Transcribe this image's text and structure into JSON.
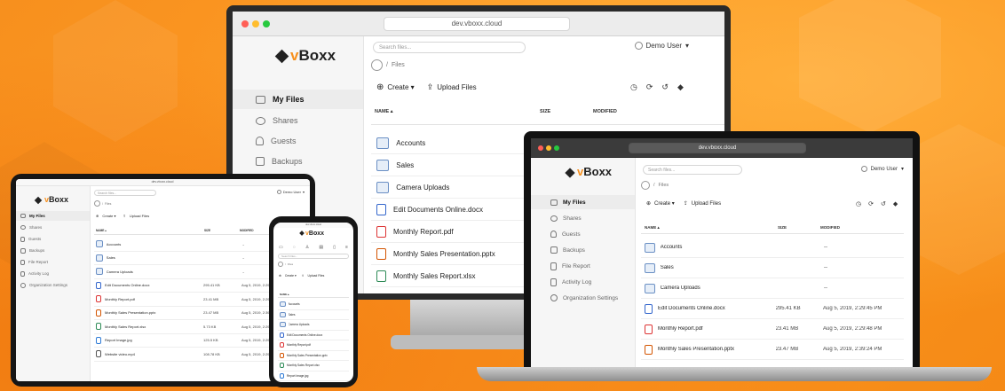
{
  "url": "dev.vboxx.cloud",
  "brand": {
    "prefix": "v",
    "name": "Boxx"
  },
  "user": "Demo User",
  "search_placeholder": "Search files...",
  "breadcrumb": "Files",
  "toolbar": {
    "create": "Create ▾",
    "upload": "Upload Files"
  },
  "nav": [
    {
      "label": "My Files",
      "icon": "folder-icon"
    },
    {
      "label": "Shares",
      "icon": "share-icon"
    },
    {
      "label": "Guests",
      "icon": "guest-icon"
    },
    {
      "label": "Backups",
      "icon": "backup-icon"
    },
    {
      "label": "File Report",
      "icon": "report-icon"
    },
    {
      "label": "Activity Log",
      "icon": "log-icon"
    },
    {
      "label": "Organization Settings",
      "icon": "settings-icon"
    }
  ],
  "columns": {
    "name": "NAME ▴",
    "size": "SIZE",
    "modified": "MODIFIED"
  },
  "files_monitor": [
    {
      "name": "Accounts",
      "type": "folder"
    },
    {
      "name": "Sales",
      "type": "folder"
    },
    {
      "name": "Camera Uploads",
      "type": "folder"
    },
    {
      "name": "Edit Documents Online.docx",
      "type": "doc"
    },
    {
      "name": "Monthly Report.pdf",
      "type": "pdf"
    },
    {
      "name": "Monthly Sales Presentation.pptx",
      "type": "ppt"
    },
    {
      "name": "Monthly Sales Report.xlsx",
      "type": "xls"
    }
  ],
  "files_laptop": [
    {
      "name": "Accounts",
      "type": "folder",
      "size": "",
      "modified": "--"
    },
    {
      "name": "Sales",
      "type": "folder",
      "size": "",
      "modified": "--"
    },
    {
      "name": "Camera Uploads",
      "type": "folder",
      "size": "",
      "modified": "--"
    },
    {
      "name": "Edit Documents Online.docx",
      "type": "doc",
      "size": "295.41 KB",
      "modified": "Aug 5, 2019, 2:29:45 PM"
    },
    {
      "name": "Monthly Report.pdf",
      "type": "pdf",
      "size": "23.41 MB",
      "modified": "Aug 5, 2019, 2:29:48 PM"
    },
    {
      "name": "Monthly Sales Presentation.pptx",
      "type": "ppt",
      "size": "23.47 MB",
      "modified": "Aug 5, 2019, 2:39:24 PM"
    }
  ],
  "files_tablet": [
    {
      "name": "Accounts",
      "type": "folder",
      "size": "",
      "modified": "--"
    },
    {
      "name": "Sales",
      "type": "folder",
      "size": "",
      "modified": "--"
    },
    {
      "name": "Camera Uploads",
      "type": "folder",
      "size": "",
      "modified": "--"
    },
    {
      "name": "Edit Documents Online.docx",
      "type": "doc",
      "size": "295.41 KB",
      "modified": "Aug 5, 2019, 2:29:45 PM"
    },
    {
      "name": "Monthly Report.pdf",
      "type": "pdf",
      "size": "23.41 MB",
      "modified": "Aug 5, 2019, 2:29:48 PM"
    },
    {
      "name": "Monthly Sales Presentation.pptx",
      "type": "ppt",
      "size": "23.47 MB",
      "modified": "Aug 5, 2019, 2:39:24 PM"
    },
    {
      "name": "Monthly Sales Report.xlsx",
      "type": "xls",
      "size": "5.73 KB",
      "modified": "Aug 5, 2019, 2:29:48 PM"
    },
    {
      "name": "Report Image.jpg",
      "type": "img",
      "size": "125.5 KB",
      "modified": "Aug 5, 2019, 2:29:48 PM"
    },
    {
      "name": "Website video.mp4",
      "type": "vid",
      "size": "108.78 KB",
      "modified": "Aug 5, 2019, 2:29:48 PM"
    }
  ],
  "files_phone": [
    {
      "name": "Accounts",
      "type": "folder"
    },
    {
      "name": "Sales",
      "type": "folder"
    },
    {
      "name": "Camera Uploads",
      "type": "folder"
    },
    {
      "name": "Edit Documents Online.docx",
      "type": "doc"
    },
    {
      "name": "Monthly Report.pdf",
      "type": "pdf"
    },
    {
      "name": "Monthly Sales Presentation.pptx",
      "type": "ppt"
    },
    {
      "name": "Monthly Sales Report.xlsx",
      "type": "xls"
    },
    {
      "name": "Report Image.jpg",
      "type": "img"
    }
  ],
  "colors": {
    "brand": "#f7901e",
    "folder": "#6a8fc4",
    "pdf": "#d33333"
  }
}
